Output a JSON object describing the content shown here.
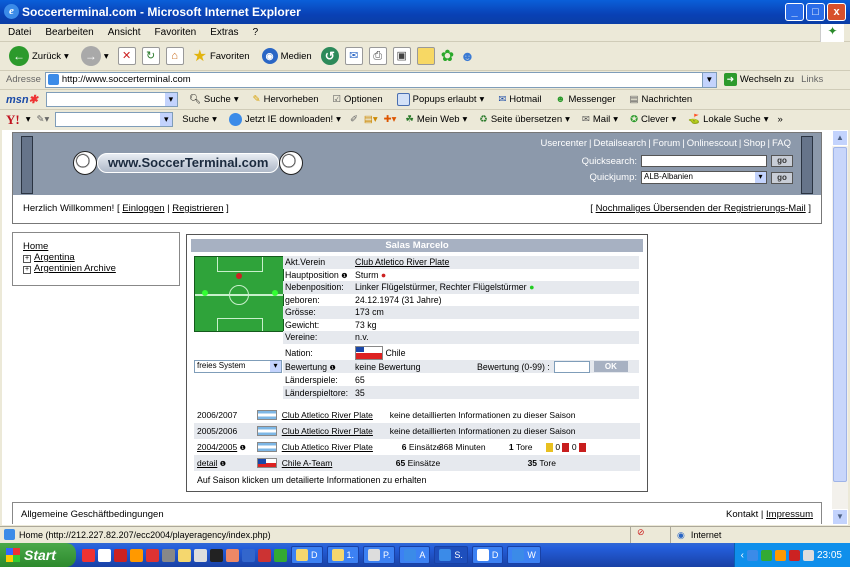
{
  "window": {
    "title": "Soccerterminal.com - Microsoft Internet Explorer",
    "controls": [
      "_",
      "□",
      "x"
    ]
  },
  "menu": [
    "Datei",
    "Bearbeiten",
    "Ansicht",
    "Favoriten",
    "Extras",
    "?"
  ],
  "toolbar": {
    "back": "Zurück",
    "favorites": "Favoriten",
    "media": "Medien"
  },
  "address": {
    "label": "Adresse",
    "url": "http://www.soccerterminal.com",
    "go": "Wechseln zu",
    "links": "Links"
  },
  "msn_bar": {
    "search": "Suche",
    "highlight": "Hervorheben",
    "options": "Optionen",
    "popups": "Popups erlaubt",
    "hotmail": "Hotmail",
    "messenger": "Messenger",
    "news": "Nachrichten"
  },
  "yahoo_bar": {
    "search": "Suche",
    "download": "Jetzt IE downloaden!",
    "myweb": "Mein Web",
    "translate": "Seite übersetzen",
    "mail": "Mail",
    "clever": "Clever",
    "local": "Lokale Suche"
  },
  "site": {
    "logo": "www.SoccerTerminal.com",
    "top_links": [
      "Usercenter",
      "Detailsearch",
      "Forum",
      "Onlinescout",
      "Shop",
      "FAQ"
    ],
    "quicksearch_label": "Quicksearch:",
    "quickjump_label": "Quickjump:",
    "quickjump_value": "ALB-Albanien",
    "go": "go",
    "welcome": "Herzlich Willkommen!",
    "login": "Einloggen",
    "register": "Registrieren",
    "resend": "Nochmaliges Übersenden der Registrierungs-Mail"
  },
  "nav": {
    "home": "Home",
    "items": [
      "Argentina",
      "Argentinien Archive"
    ]
  },
  "player": {
    "name": "Salas Marcelo",
    "rows": [
      {
        "label": "Akt.Verein",
        "value": "Club Atletico River Plate"
      },
      {
        "label": "Hauptposition",
        "value": "Sturm"
      },
      {
        "label": "Nebenposition:",
        "value": "Linker Flügelstürmer, Rechter Flügelstürmer"
      },
      {
        "label": "geboren:",
        "value": "24.12.1974 (31 Jahre)"
      },
      {
        "label": "Grösse:",
        "value": "173 cm"
      },
      {
        "label": "Gewicht:",
        "value": "73 kg"
      },
      {
        "label": "Vereine:",
        "value": "n.v."
      },
      {
        "label": "Nation:",
        "value": "Chile"
      }
    ],
    "system": "freies System",
    "rating_label": "Bewertung",
    "rating_value": "keine Bewertung",
    "rating_input_label": "Bewertung (0-99) :",
    "ok": "OK",
    "caps_label": "Länderspiele:",
    "caps": "65",
    "goals_label": "Länderspieltore:",
    "goals": "35",
    "seasons": [
      {
        "season": "2006/2007",
        "club": "Club Atletico River Plate",
        "info": "keine detaillierten Informationen zu dieser Saison"
      },
      {
        "season": "2005/2006",
        "club": "Club Atletico River Plate",
        "info": "keine detaillierten Informationen zu dieser Saison"
      },
      {
        "season": "2004/2005",
        "club": "Club Atletico River Plate",
        "apps": "6",
        "apps_label": "Einsätze",
        "minutes": "368 Minuten",
        "goals": "1",
        "goals_label": "Tore",
        "yellow": "0",
        "red": "0"
      },
      {
        "season": "detail",
        "club": "Chile A-Team",
        "apps": "65",
        "apps_label": "Einsätze",
        "goals": "35",
        "goals_label": "Tore"
      }
    ],
    "note": "Auf Saison klicken um detailierte Informationen zu erhalten"
  },
  "footer": {
    "terms": "Allgemeine Geschäftbedingungen",
    "contact": "Kontakt",
    "imprint": "Impressum"
  },
  "status": {
    "text": "Home (http://212.227.82.207/ecc2004/playeragency/index.php)",
    "zone": "Internet"
  },
  "taskbar": {
    "start": "Start",
    "tasks": [
      "D",
      "1.",
      "P.",
      "A",
      "S.",
      "D",
      "W"
    ],
    "clock": "23:05"
  },
  "colors": {
    "titlebar": "#0A5FD9",
    "header_band": "#8C99AB",
    "pitch": "#2FA33A",
    "row_alt": "#E6E9EE"
  }
}
